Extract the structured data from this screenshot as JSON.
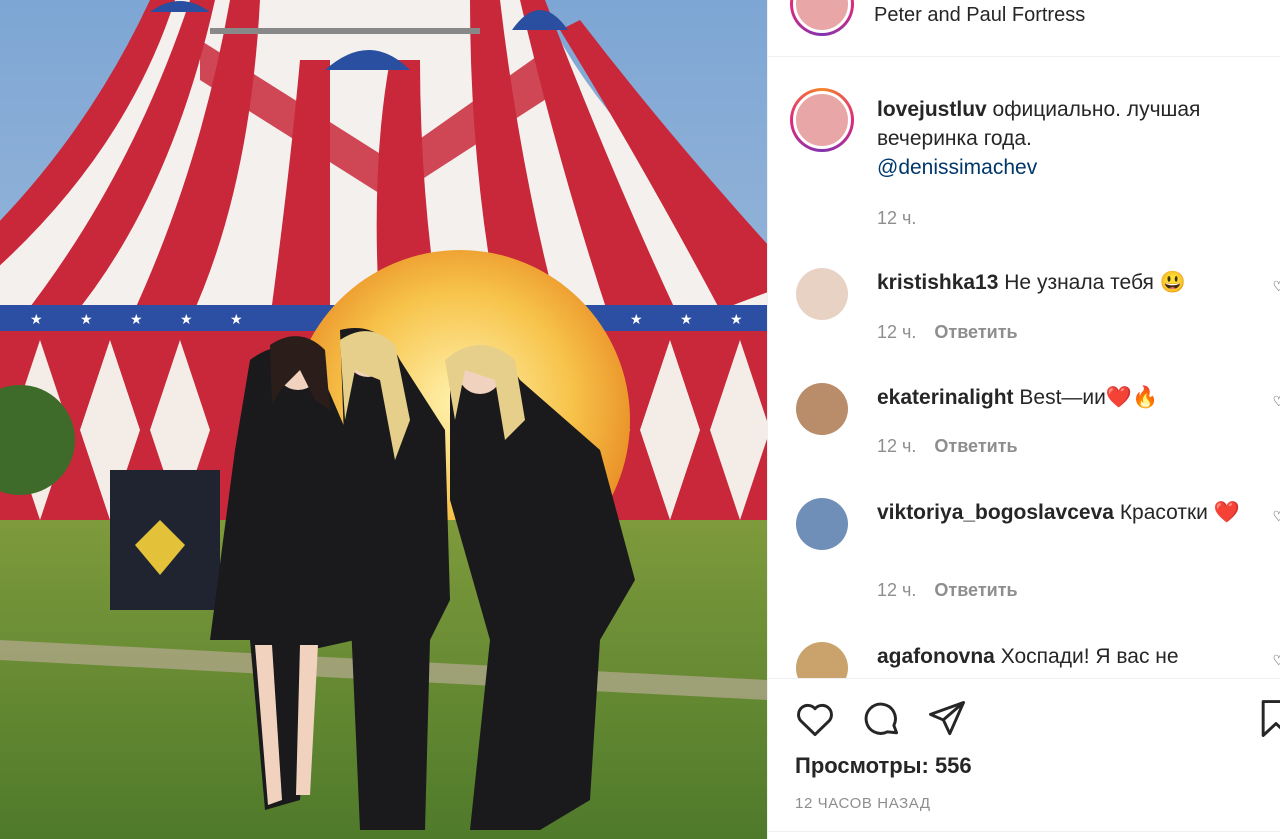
{
  "post": {
    "location": "Peter and Paul Fortress",
    "author": "lovejustluv",
    "caption_text": "официально. лучшая вечеринка года.",
    "caption_mention": "@denissimachev",
    "caption_time": "12 ч."
  },
  "comments": [
    {
      "username": "kristishka13",
      "text": "Не узнала тебя 😃",
      "time": "12 ч.",
      "reply": "Ответить",
      "avatar_color": "#e8d2c4"
    },
    {
      "username": "ekaterinalight",
      "text": "Best—ии❤️🔥",
      "time": "12 ч.",
      "reply": "Ответить",
      "avatar_color": "#b98c6a"
    },
    {
      "username": "viktoriya_bogoslavceva",
      "text": "Красотки ❤️",
      "time": "12 ч.",
      "reply": "Ответить",
      "avatar_color": "#6f8fb8"
    },
    {
      "username": "agafonovna",
      "text": "Хоспади! Я вас не",
      "avatar_color": "#c9a36b"
    }
  ],
  "stats": {
    "views": "Просмотры: 556",
    "time_ago": "12 ЧАСОВ НАЗАД"
  },
  "colors": {
    "mention": "#00376b",
    "muted": "#8e8e8e",
    "tent_red": "#c8283a",
    "sky": "#8fb2d6"
  },
  "icons": [
    "heart-icon",
    "comment-icon",
    "share-icon",
    "bookmark-icon",
    "more-icon"
  ]
}
